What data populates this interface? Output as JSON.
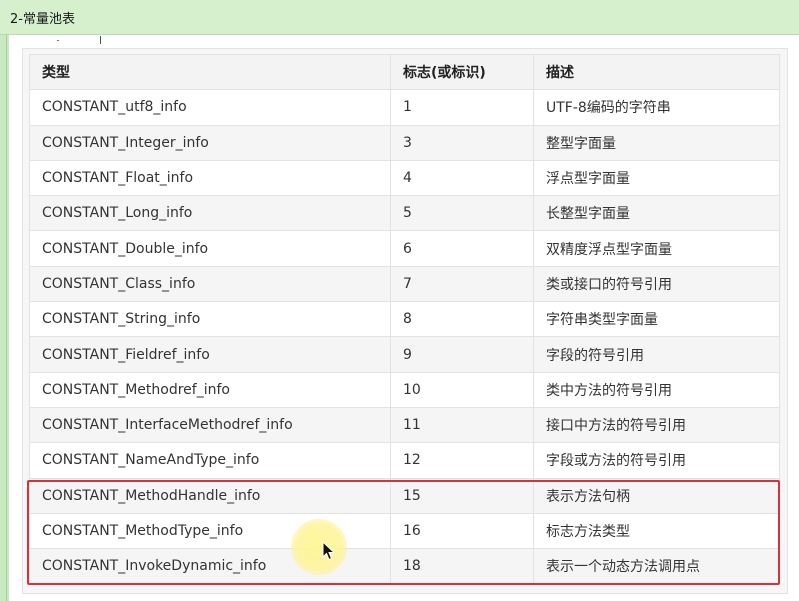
{
  "window": {
    "title": "2-常量池表"
  },
  "table": {
    "headers": [
      "类型",
      "标志(或标识)",
      "描述"
    ],
    "rows": [
      [
        "CONSTANT_utf8_info",
        "1",
        "UTF-8编码的字符串"
      ],
      [
        "CONSTANT_Integer_info",
        "3",
        "整型字面量"
      ],
      [
        "CONSTANT_Float_info",
        "4",
        "浮点型字面量"
      ],
      [
        "CONSTANT_Long_info",
        "5",
        "长整型字面量"
      ],
      [
        "CONSTANT_Double_info",
        "6",
        "双精度浮点型字面量"
      ],
      [
        "CONSTANT_Class_info",
        "7",
        "类或接口的符号引用"
      ],
      [
        "CONSTANT_String_info",
        "8",
        "字符串类型字面量"
      ],
      [
        "CONSTANT_Fieldref_info",
        "9",
        "字段的符号引用"
      ],
      [
        "CONSTANT_Methodref_info",
        "10",
        "类中方法的符号引用"
      ],
      [
        "CONSTANT_InterfaceMethodref_info",
        "11",
        "接口中方法的符号引用"
      ],
      [
        "CONSTANT_NameAndType_info",
        "12",
        "字段或方法的符号引用"
      ],
      [
        "CONSTANT_MethodHandle_info",
        "15",
        "表示方法句柄"
      ],
      [
        "CONSTANT_MethodType_info",
        "16",
        "标志方法类型"
      ],
      [
        "CONSTANT_InvokeDynamic_info",
        "18",
        "表示一个动态方法调用点"
      ]
    ]
  },
  "colors": {
    "background": "#c9eac0",
    "highlight_border": "#d6323c",
    "cursor_highlight": "#fff396"
  },
  "icons": {
    "cursor": "mouse-pointer-icon"
  }
}
